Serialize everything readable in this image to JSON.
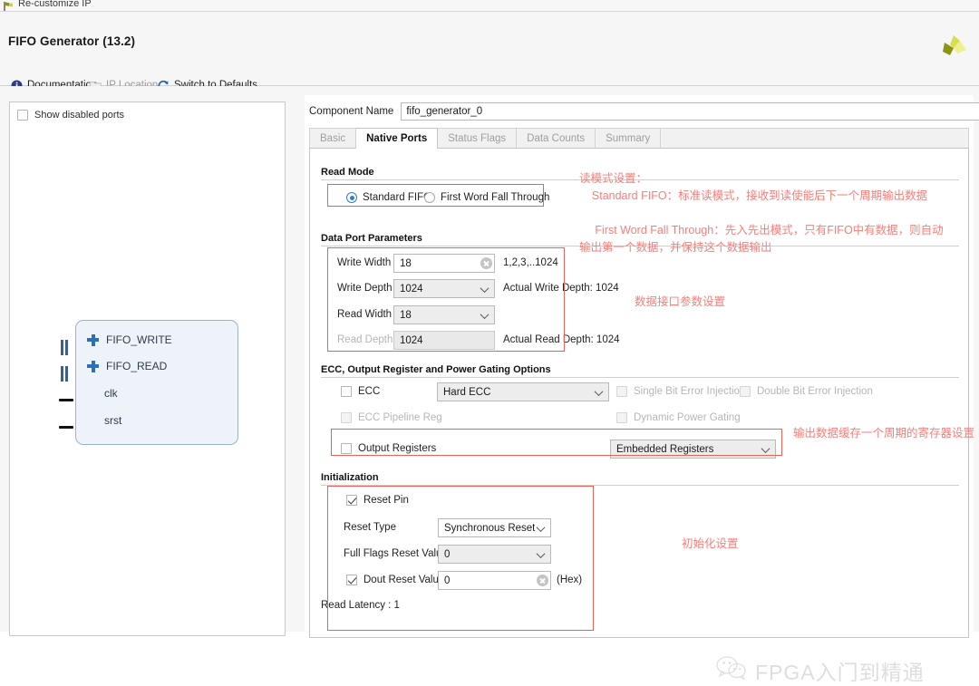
{
  "window": {
    "title": "Re-customize IP",
    "icon": "xilinx-flag-icon"
  },
  "header": {
    "app_title": "FIFO Generator (13.2)",
    "logo_icon": "xilinx-logo-icon",
    "links": [
      {
        "label": "Documentation",
        "icon": "info-icon",
        "disabled": false
      },
      {
        "label": "IP Location",
        "icon": "folder-icon",
        "disabled": true
      },
      {
        "label": "Switch to Defaults",
        "icon": "refresh-icon",
        "disabled": false
      }
    ]
  },
  "left_panel": {
    "show_disabled_ports": {
      "label": "Show disabled ports",
      "checked": false
    },
    "symbol": {
      "ports": [
        {
          "name": "FIFO_WRITE",
          "kind": "bus"
        },
        {
          "name": "FIFO_READ",
          "kind": "bus"
        },
        {
          "name": "clk",
          "kind": "wire"
        },
        {
          "name": "srst",
          "kind": "wire"
        }
      ]
    }
  },
  "component": {
    "label": "Component Name",
    "value": "fifo_generator_0",
    "placeholder": "fifo_generator_0"
  },
  "tabs": [
    {
      "label": "Basic",
      "active": false
    },
    {
      "label": "Native Ports",
      "active": true
    },
    {
      "label": "Status Flags",
      "active": false
    },
    {
      "label": "Data Counts",
      "active": false
    },
    {
      "label": "Summary",
      "active": false
    }
  ],
  "sections": {
    "read_mode": {
      "title": "Read Mode",
      "options": [
        {
          "label": "Standard FIFO",
          "selected": true
        },
        {
          "label": "First Word Fall Through",
          "selected": false
        }
      ]
    },
    "data_port": {
      "title": "Data Port Parameters",
      "write_width": {
        "label": "Write Width",
        "value": "18",
        "hint": "1,2,3,..1024",
        "clear_icon": "clear-icon"
      },
      "write_depth": {
        "label": "Write Depth",
        "value": "1024",
        "hint": "Actual Write Depth: 1024"
      },
      "read_width": {
        "label": "Read Width",
        "value": "18",
        "hint": ""
      },
      "read_depth": {
        "label": "Read Depth",
        "value": "1024",
        "hint": "Actual Read Depth: 1024",
        "disabled": true
      }
    },
    "ecc": {
      "title": "ECC, Output Register and Power Gating Options",
      "ecc_checkbox": {
        "label": "ECC",
        "checked": false,
        "disabled": false
      },
      "ecc_combo": {
        "value": "Hard ECC"
      },
      "single_bit": {
        "label": "Single Bit Error Injection",
        "checked": false,
        "disabled": true
      },
      "double_bit": {
        "label": "Double Bit Error Injection",
        "checked": false,
        "disabled": true
      },
      "ecc_pipeline": {
        "label": "ECC Pipeline Reg",
        "checked": false,
        "disabled": true
      },
      "dynamic_power": {
        "label": "Dynamic Power Gating",
        "checked": false,
        "disabled": true
      },
      "output_registers": {
        "label": "Output Registers",
        "checked": false,
        "disabled": false
      },
      "output_combo": {
        "value": "Embedded Registers"
      }
    },
    "initialization": {
      "title": "Initialization",
      "reset_pin": {
        "label": "Reset Pin",
        "checked": true
      },
      "reset_type": {
        "label": "Reset Type",
        "value": "Synchronous Reset"
      },
      "full_flags_reset": {
        "label": "Full Flags Reset Value",
        "value": "0",
        "disabled": true
      },
      "dout_reset": {
        "label": "Dout Reset Value",
        "checked": true,
        "value": "0",
        "suffix": "(Hex)",
        "clear_icon": "clear-icon"
      },
      "read_latency": "Read Latency : 1"
    }
  },
  "annotations": {
    "color": "#fb7d78",
    "read_mode": "读模式设置：\n    Standard FIFO：标准读模式，接收到读使能后下一个周期输出数据\n\n     First Word Fall Through：先入先出模式，只有FIFO中有数据，则自动\n输出第一个数据，并保持这个数据输出",
    "data_port": "数据接口参数设置",
    "output_reg": "输出数据缓存一个周期的寄存器设置",
    "initialization": "初始化设置"
  },
  "watermark": {
    "text": "FPGA入门到精通",
    "icon": "wechat-icon"
  }
}
